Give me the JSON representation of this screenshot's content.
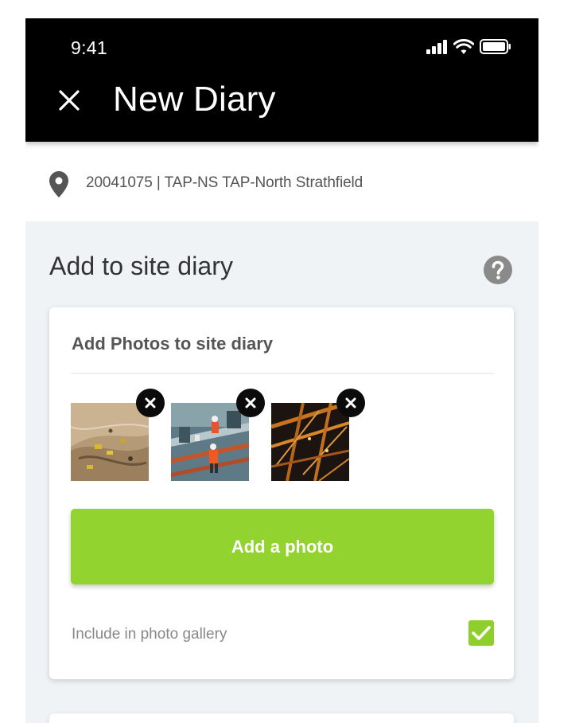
{
  "status_bar": {
    "time": "9:41"
  },
  "header": {
    "title": "New Diary",
    "close_icon": "close-icon"
  },
  "location": {
    "icon": "map-pin-icon",
    "text": "20041075 | TAP-NS TAP-North Strathfield"
  },
  "section": {
    "title": "Add to site diary",
    "help_icon": "help-icon"
  },
  "photos_card": {
    "title": "Add Photos to site diary",
    "photos": [
      {
        "name": "construction-site-aerial-photo",
        "remove_icon": "close-icon"
      },
      {
        "name": "workers-on-site-photo",
        "remove_icon": "close-icon"
      },
      {
        "name": "steel-structure-night-photo",
        "remove_icon": "close-icon"
      }
    ],
    "add_button_label": "Add a photo",
    "include_gallery_label": "Include in photo gallery",
    "include_gallery_checked": true
  },
  "colors": {
    "accent": "#93d32f",
    "header_bg": "#000000",
    "page_bg": "#eff3f6"
  }
}
